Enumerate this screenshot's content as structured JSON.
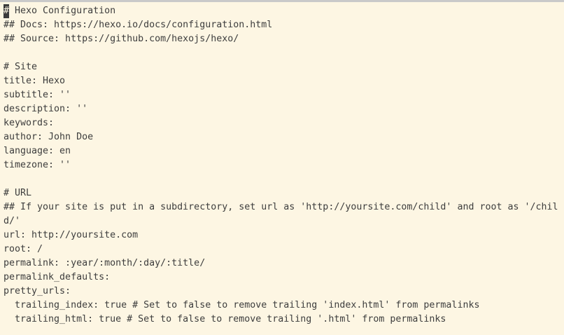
{
  "editor": {
    "cursor_char": "#",
    "lines": [
      " Hexo Configuration",
      "## Docs: https://hexo.io/docs/configuration.html",
      "## Source: https://github.com/hexojs/hexo/",
      "",
      "# Site",
      "title: Hexo",
      "subtitle: ''",
      "description: ''",
      "keywords:",
      "author: John Doe",
      "language: en",
      "timezone: ''",
      "",
      "# URL",
      "## If your site is put in a subdirectory, set url as 'http://yoursite.com/child' and root as '/chil",
      "d/'",
      "url: http://yoursite.com",
      "root: /",
      "permalink: :year/:month/:day/:title/",
      "permalink_defaults:",
      "pretty_urls:",
      "  trailing_index: true # Set to false to remove trailing 'index.html' from permalinks",
      "  trailing_html: true # Set to false to remove trailing '.html' from permalinks"
    ]
  }
}
